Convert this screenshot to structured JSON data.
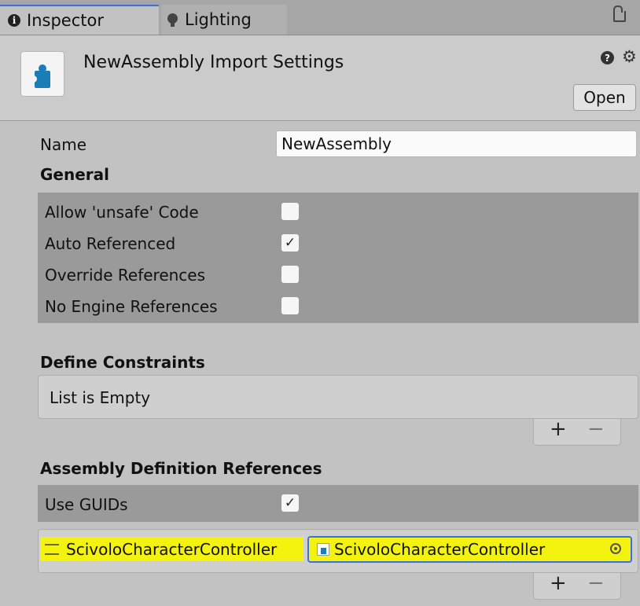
{
  "tabs": [
    {
      "label": "Inspector",
      "icon": "info-icon",
      "active": true
    },
    {
      "label": "Lighting",
      "icon": "lightbulb-icon",
      "active": false
    }
  ],
  "header": {
    "title": "NewAssembly Import Settings",
    "open_label": "Open",
    "help_glyph": "?",
    "gear_glyph": "⚙"
  },
  "fields": {
    "name_label": "Name",
    "name_value": "NewAssembly"
  },
  "general": {
    "heading": "General",
    "options": [
      {
        "label": "Allow 'unsafe' Code",
        "checked": false
      },
      {
        "label": "Auto Referenced",
        "checked": true
      },
      {
        "label": "Override References",
        "checked": false
      },
      {
        "label": "No Engine References",
        "checked": false
      }
    ]
  },
  "define_constraints": {
    "heading": "Define Constraints",
    "empty_text": "List is Empty",
    "add": "+",
    "remove": "−"
  },
  "assembly_refs": {
    "heading": "Assembly Definition References",
    "use_guids_label": "Use GUIDs",
    "use_guids_checked": true,
    "items": [
      {
        "label": "ScivoloCharacterController",
        "value": "ScivoloCharacterController"
      }
    ],
    "add": "+",
    "remove": "−"
  },
  "colors": {
    "accent": "#3a72d8",
    "highlight": "#f3f30f",
    "panel": "#c2c2c2",
    "section_bg": "#9a9a9a"
  }
}
